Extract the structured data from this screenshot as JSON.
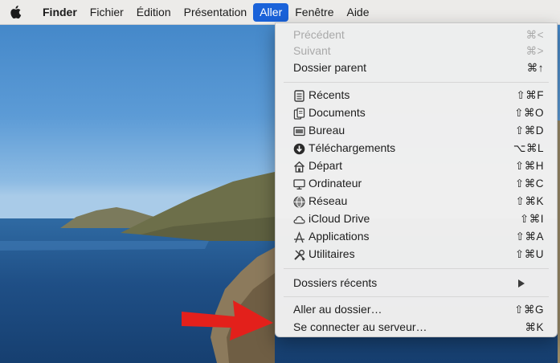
{
  "menubar": {
    "app_name": "Finder",
    "items": [
      "Fichier",
      "Édition",
      "Présentation",
      "Aller",
      "Fenêtre",
      "Aide"
    ]
  },
  "go_menu": {
    "nav": [
      {
        "label": "Précédent",
        "shortcut": "⌘<",
        "enabled": false
      },
      {
        "label": "Suivant",
        "shortcut": "⌘>",
        "enabled": false
      },
      {
        "label": "Dossier parent",
        "shortcut": "⌘↑",
        "enabled": true
      }
    ],
    "places": [
      {
        "label": "Récents",
        "shortcut": "⇧⌘F",
        "icon": "recents-icon"
      },
      {
        "label": "Documents",
        "shortcut": "⇧⌘O",
        "icon": "documents-icon"
      },
      {
        "label": "Bureau",
        "shortcut": "⇧⌘D",
        "icon": "desktop-icon"
      },
      {
        "label": "Téléchargements",
        "shortcut": "⌥⌘L",
        "icon": "downloads-icon"
      },
      {
        "label": "Départ",
        "shortcut": "⇧⌘H",
        "icon": "home-icon"
      },
      {
        "label": "Ordinateur",
        "shortcut": "⇧⌘C",
        "icon": "computer-icon"
      },
      {
        "label": "Réseau",
        "shortcut": "⇧⌘K",
        "icon": "network-icon"
      },
      {
        "label": "iCloud Drive",
        "shortcut": "⇧⌘I",
        "icon": "icloud-icon"
      },
      {
        "label": "Applications",
        "shortcut": "⇧⌘A",
        "icon": "applications-icon"
      },
      {
        "label": "Utilitaires",
        "shortcut": "⇧⌘U",
        "icon": "utilities-icon"
      }
    ],
    "recent_folders": {
      "label": "Dossiers récents"
    },
    "goto": [
      {
        "label": "Aller au dossier…",
        "shortcut": "⇧⌘G"
      },
      {
        "label": "Se connecter au serveur…",
        "shortcut": "⌘K"
      }
    ]
  },
  "colors": {
    "menu_highlight": "#1a62d9",
    "arrow": "#e3201b"
  }
}
